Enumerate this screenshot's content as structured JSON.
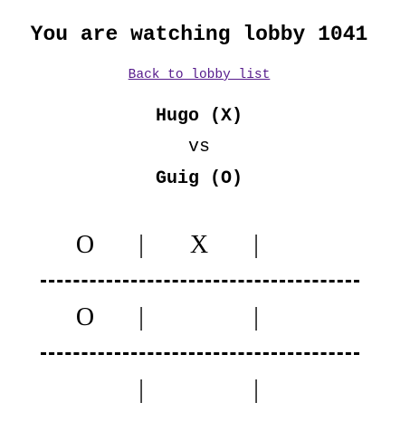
{
  "heading": "You are watching lobby 1041",
  "back_link": "Back to lobby list",
  "players": {
    "x_player": "Hugo (X)",
    "vs": "vs",
    "o_player": "Guig (O)"
  },
  "board": {
    "separator": "|",
    "rows": [
      [
        "O",
        "X",
        ""
      ],
      [
        "O",
        "",
        ""
      ],
      [
        "",
        "",
        ""
      ]
    ]
  }
}
